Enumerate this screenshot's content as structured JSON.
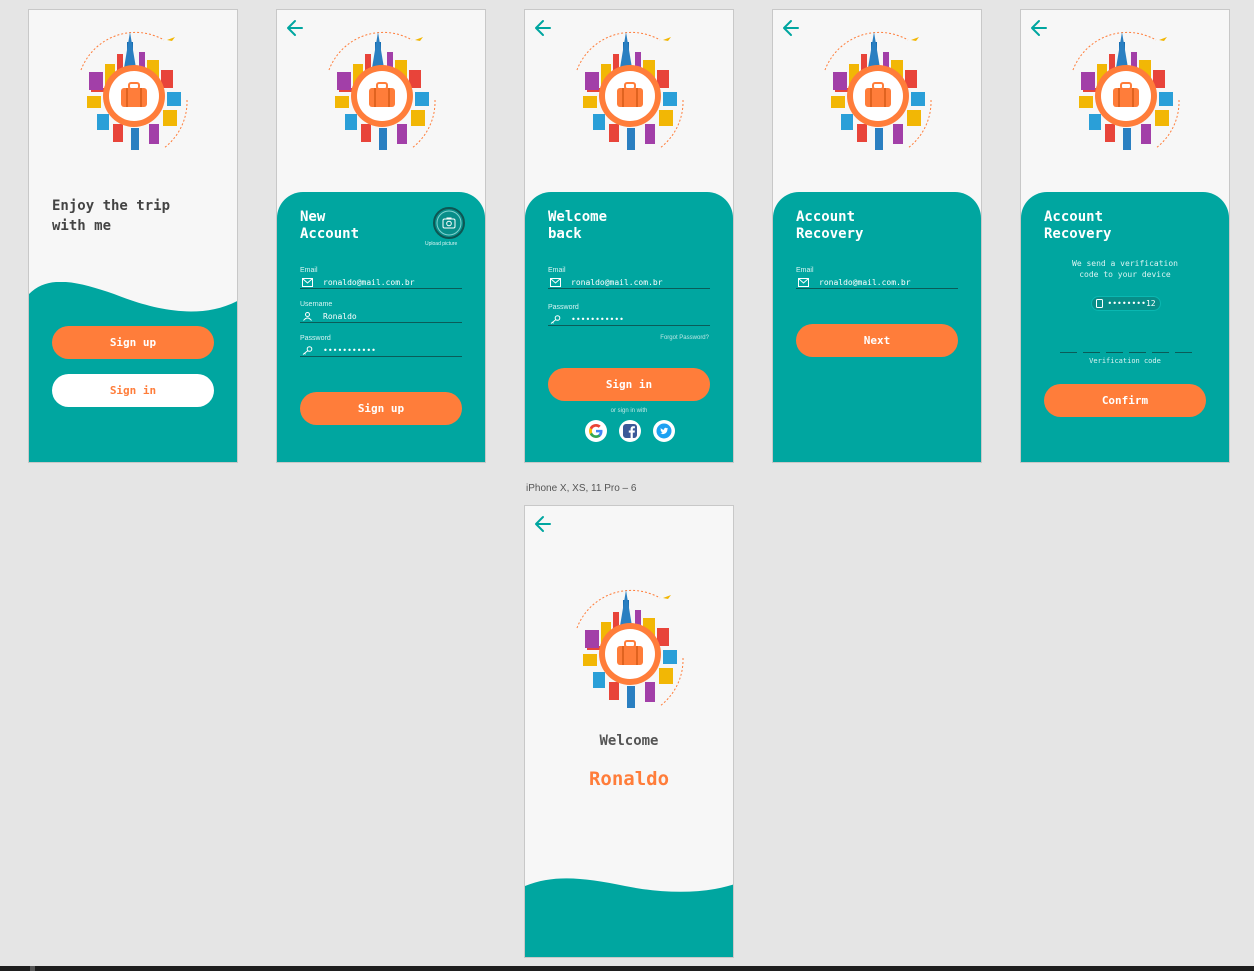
{
  "colors": {
    "teal": "#00a6a0",
    "orange": "#ff7d3a",
    "canvas": "#e5e5e5",
    "screen": "#f7f7f7"
  },
  "canvas": {
    "artboard_label": "iPhone X, XS, 11 Pro – 6"
  },
  "screen1": {
    "tagline": "Enjoy the trip\nwith me",
    "sign_up": "Sign up",
    "sign_in": "Sign in"
  },
  "screen2": {
    "title": "New\nAccount",
    "camera_icon": "camera-icon",
    "upload_label": "Upload picture",
    "email_label": "Email",
    "email_value": "ronaldo@mail.com.br",
    "username_label": "Username",
    "username_value": "Ronaldo",
    "password_label": "Password",
    "password_value": "•••••••••••",
    "submit": "Sign up"
  },
  "screen3": {
    "title": "Welcome\nback",
    "email_label": "Email",
    "email_value": "ronaldo@mail.com.br",
    "password_label": "Password",
    "password_value": "•••••••••••",
    "forgot": "Forgot Password?",
    "submit": "Sign in",
    "or_sign_in": "or sign in with",
    "social": [
      "google-icon",
      "facebook-icon",
      "twitter-icon"
    ]
  },
  "screen4": {
    "title": "Account\nRecovery",
    "email_label": "Email",
    "email_value": "ronaldo@mail.com.br",
    "submit": "Next"
  },
  "screen5": {
    "title": "Account\nRecovery",
    "message": "We send a verification code to your device",
    "phone": "••••••••12",
    "code_label": "Verification code",
    "submit": "Confirm"
  },
  "screen6": {
    "welcome": "Welcome",
    "name": "Ronaldo"
  }
}
